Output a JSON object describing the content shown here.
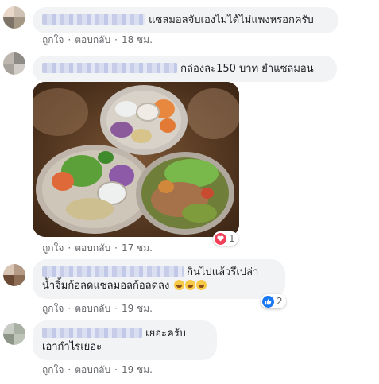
{
  "comments": [
    {
      "text": "แซลมอลจับเองไม่ได้ไม่แพงหรอกครับ",
      "actions": {
        "like": "ถูกใจ",
        "reply": "ตอบกลับ",
        "time": "18 ชม."
      }
    },
    {
      "text": "กล่องละ150 บาท ยำแซลมอน",
      "actions": {
        "like": "ถูกใจ",
        "reply": "ตอบกลับ",
        "time": "17 ชม."
      },
      "reaction_count": "1",
      "reaction_icon": "heart-icon"
    },
    {
      "text_line1": "กินไปแล้วรึเปล่า",
      "text_line2": "น้ำจิ้มก้อลดแซลมอลก้อลดลง",
      "actions": {
        "like": "ถูกใจ",
        "reply": "ตอบกลับ",
        "time": "19 ชม."
      },
      "reaction_count": "2",
      "reaction_icon": "like-icon"
    },
    {
      "text_line1": "เยอะครับ",
      "text_line2": "เอากำไรเยอะ",
      "actions": {
        "like": "ถูกใจ",
        "reply": "ตอบกลับ",
        "time": "19 ชม."
      }
    }
  ],
  "colors": {
    "bubble": "#f2f3f5",
    "meta_text": "#65676b",
    "heart": "#f33e58",
    "like": "#1877f2"
  }
}
